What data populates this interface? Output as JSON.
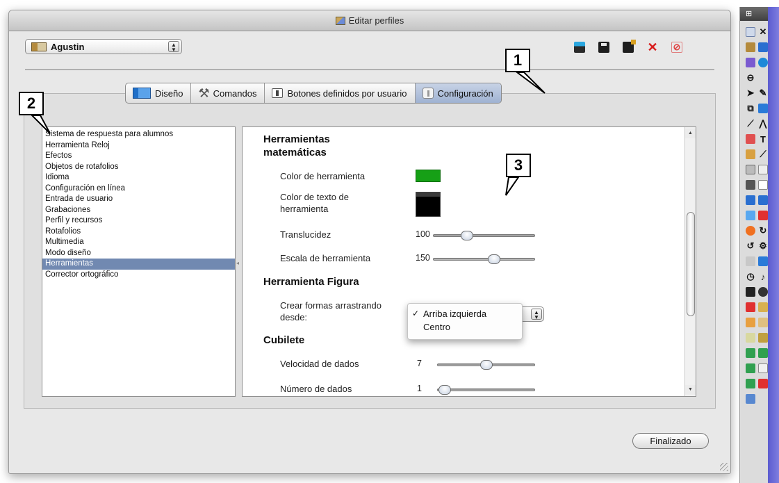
{
  "window": {
    "title": "Editar perfiles"
  },
  "profile": {
    "selected": "Agustin"
  },
  "toolbar": {
    "icons": [
      "new-profile-icon",
      "save-icon",
      "save-as-icon",
      "delete-icon",
      "reset-icon"
    ]
  },
  "tabs": [
    {
      "label": "Diseño",
      "icon": "design-icon",
      "active": false
    },
    {
      "label": "Comandos",
      "icon": "tools-icon",
      "active": false
    },
    {
      "label": "Botones definidos por usuario",
      "icon": "user-button-icon",
      "active": false
    },
    {
      "label": "Configuración",
      "icon": "settings-icon",
      "active": true
    }
  ],
  "sidebar": {
    "items": [
      {
        "label": "Sistema de respuesta para alumnos",
        "selected": false
      },
      {
        "label": "Herramienta Reloj",
        "selected": false
      },
      {
        "label": "Efectos",
        "selected": false
      },
      {
        "label": "Objetos de rotafolios",
        "selected": false
      },
      {
        "label": "Idioma",
        "selected": false
      },
      {
        "label": "Configuración en línea",
        "selected": false
      },
      {
        "label": "Entrada de usuario",
        "selected": false
      },
      {
        "label": "Grabaciones",
        "selected": false
      },
      {
        "label": "Perfil y recursos",
        "selected": false
      },
      {
        "label": "Rotafolios",
        "selected": false
      },
      {
        "label": "Multimedia",
        "selected": false
      },
      {
        "label": "Modo diseño",
        "selected": false
      },
      {
        "label": "Herramientas",
        "selected": true
      },
      {
        "label": "Corrector ortográfico",
        "selected": false
      }
    ]
  },
  "content": {
    "math_tools": {
      "title_line1": "Herramientas",
      "title_line2": "matemáticas",
      "tool_color_label": "Color de herramienta",
      "tool_color": "#16a016",
      "text_color_label_line1": "Color de texto de",
      "text_color_label_line2": "herramienta",
      "text_color": "#000000",
      "translucency_label": "Translucidez",
      "translucency_value": "100",
      "translucency_fraction": 0.33,
      "scale_label": "Escala de herramienta",
      "scale_value": "150",
      "scale_fraction": 0.6
    },
    "shape_tool": {
      "title": "Herramienta Figura",
      "create_label_line1": "Crear formas arrastrando",
      "create_label_line2": "desde:",
      "options": [
        "Arriba izquierda",
        "Centro"
      ],
      "selected_option": "Arriba izquierda",
      "checkmark": "✓"
    },
    "dice": {
      "title": "Cubilete",
      "speed_label": "Velocidad de dados",
      "speed_value": "7",
      "speed_fraction": 0.5,
      "count_label": "Número de dados",
      "count_value": "1",
      "count_fraction": 0.08
    }
  },
  "footer": {
    "done_label": "Finalizado"
  },
  "callouts": [
    "1",
    "2",
    "3"
  ],
  "colors": {
    "selection": "#7189b1",
    "active_tab": "#9fb2d2",
    "delete": "#d81c1c"
  }
}
